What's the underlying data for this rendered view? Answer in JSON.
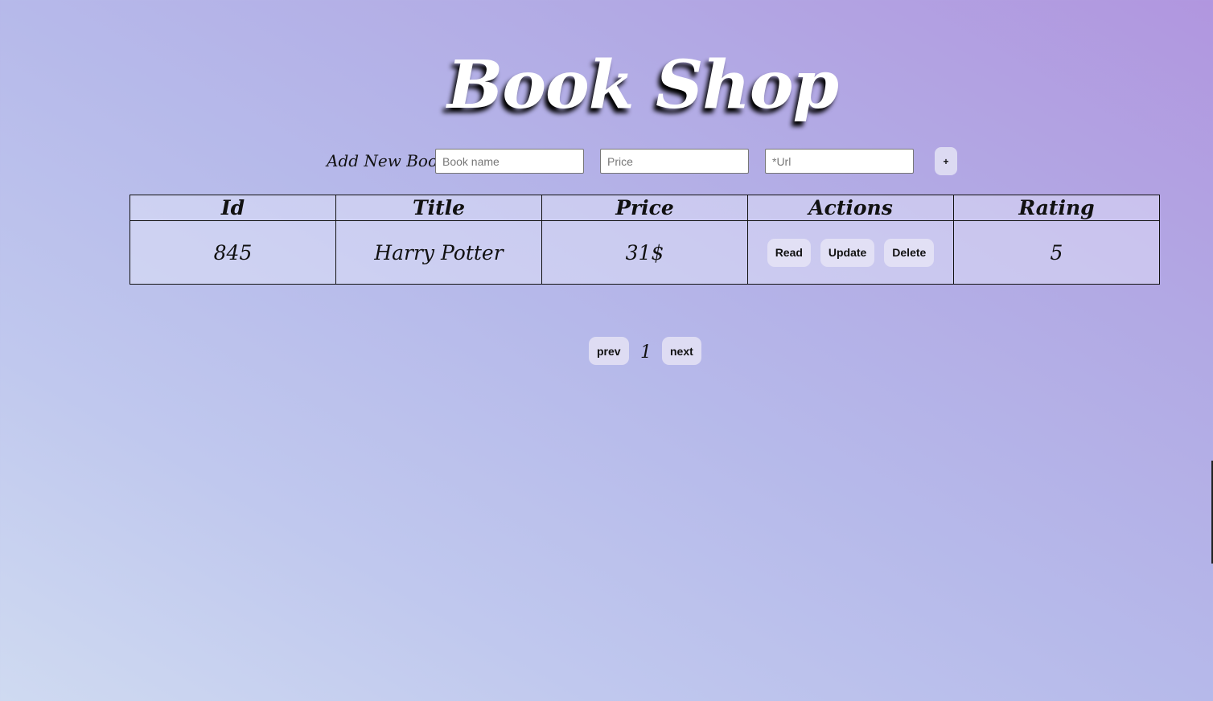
{
  "header": {
    "title": "Book Shop"
  },
  "add_form": {
    "label": "Add New Book",
    "name_placeholder": "Book name",
    "price_placeholder": "Price",
    "url_placeholder": "*Url",
    "add_button_label": "+"
  },
  "table": {
    "columns": [
      "Id",
      "Title",
      "Price",
      "Actions",
      "Rating"
    ],
    "rows": [
      {
        "id": "845",
        "title": "Harry Potter",
        "price": "31$",
        "actions": [
          "Read",
          "Update",
          "Delete"
        ],
        "rating": "5"
      }
    ]
  },
  "pagination": {
    "prev_label": "prev",
    "current_page": "1",
    "next_label": "next"
  },
  "colors": {
    "title_text": "#ffffff",
    "button_bg": "#e2e0f5",
    "gradient_start": "#cfdaf1",
    "gradient_end": "#b196df"
  }
}
